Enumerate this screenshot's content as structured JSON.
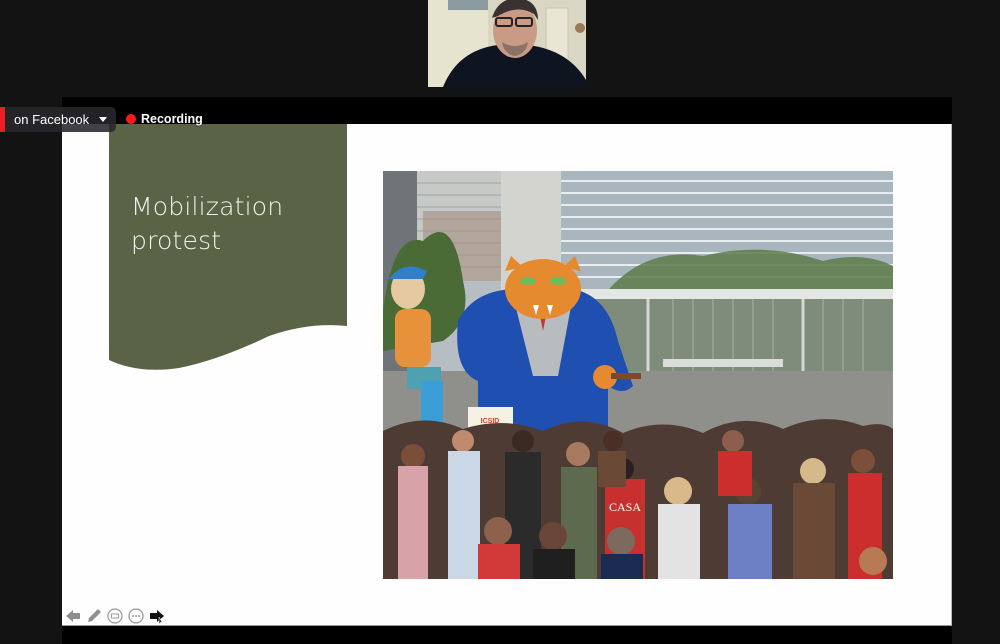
{
  "meeting": {
    "livestream_label": "on Facebook",
    "recording_label": "Recording",
    "recording_color": "#ff1a1a",
    "livestream_accent": "#ee1c25"
  },
  "participant_video": {
    "name": "participant-video"
  },
  "slide": {
    "title": "Mobilization protest",
    "title_line1": "Mobilization",
    "title_line2": "protest",
    "banner_color": "#5b6346",
    "photo_alt": "Protest crowd with giant inflatable fat cat in business suit in front of glass office building",
    "photo_sign_text": "WORLD BANK'S ICSID",
    "photo_shirt_text": "CASA"
  },
  "slideshow_controls": [
    {
      "name": "previous-slide-button",
      "icon": "arrow-left-icon"
    },
    {
      "name": "pen-tool-button",
      "icon": "pencil-icon"
    },
    {
      "name": "slide-sorter-button",
      "icon": "slides-icon"
    },
    {
      "name": "more-options-button",
      "icon": "ellipsis-icon"
    },
    {
      "name": "next-slide-button",
      "icon": "arrow-right-icon"
    }
  ]
}
